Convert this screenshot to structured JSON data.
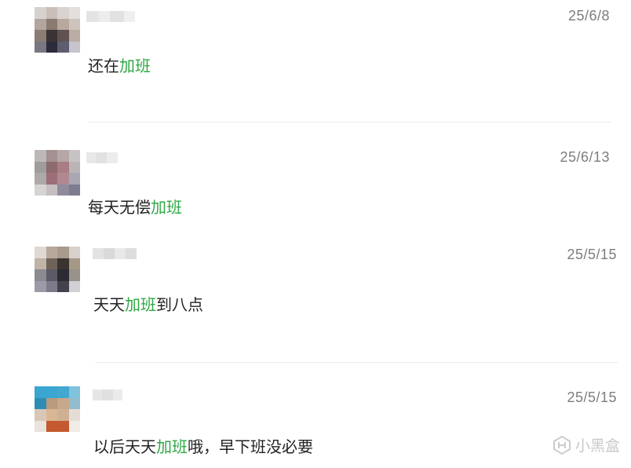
{
  "messages": [
    {
      "date": "25/6/8",
      "text_before": "还在",
      "highlight": "加班",
      "text_after": ""
    },
    {
      "date": "25/6/13",
      "text_before": "每天无偿",
      "highlight": "加班",
      "text_after": ""
    },
    {
      "date": "25/5/15",
      "text_before": "天天",
      "highlight": "加班",
      "text_after": "到八点"
    },
    {
      "date": "25/5/15",
      "text_before": "以后天天",
      "highlight": "加班",
      "text_after": "哦，早下班没必要"
    }
  ],
  "watermark": {
    "label": "小黑盒",
    "icon": "heybox-logo-icon"
  },
  "colors": {
    "highlight": "#2ea843",
    "date": "#7d7d7d",
    "text": "#222222",
    "divider": "#ebebeb"
  }
}
